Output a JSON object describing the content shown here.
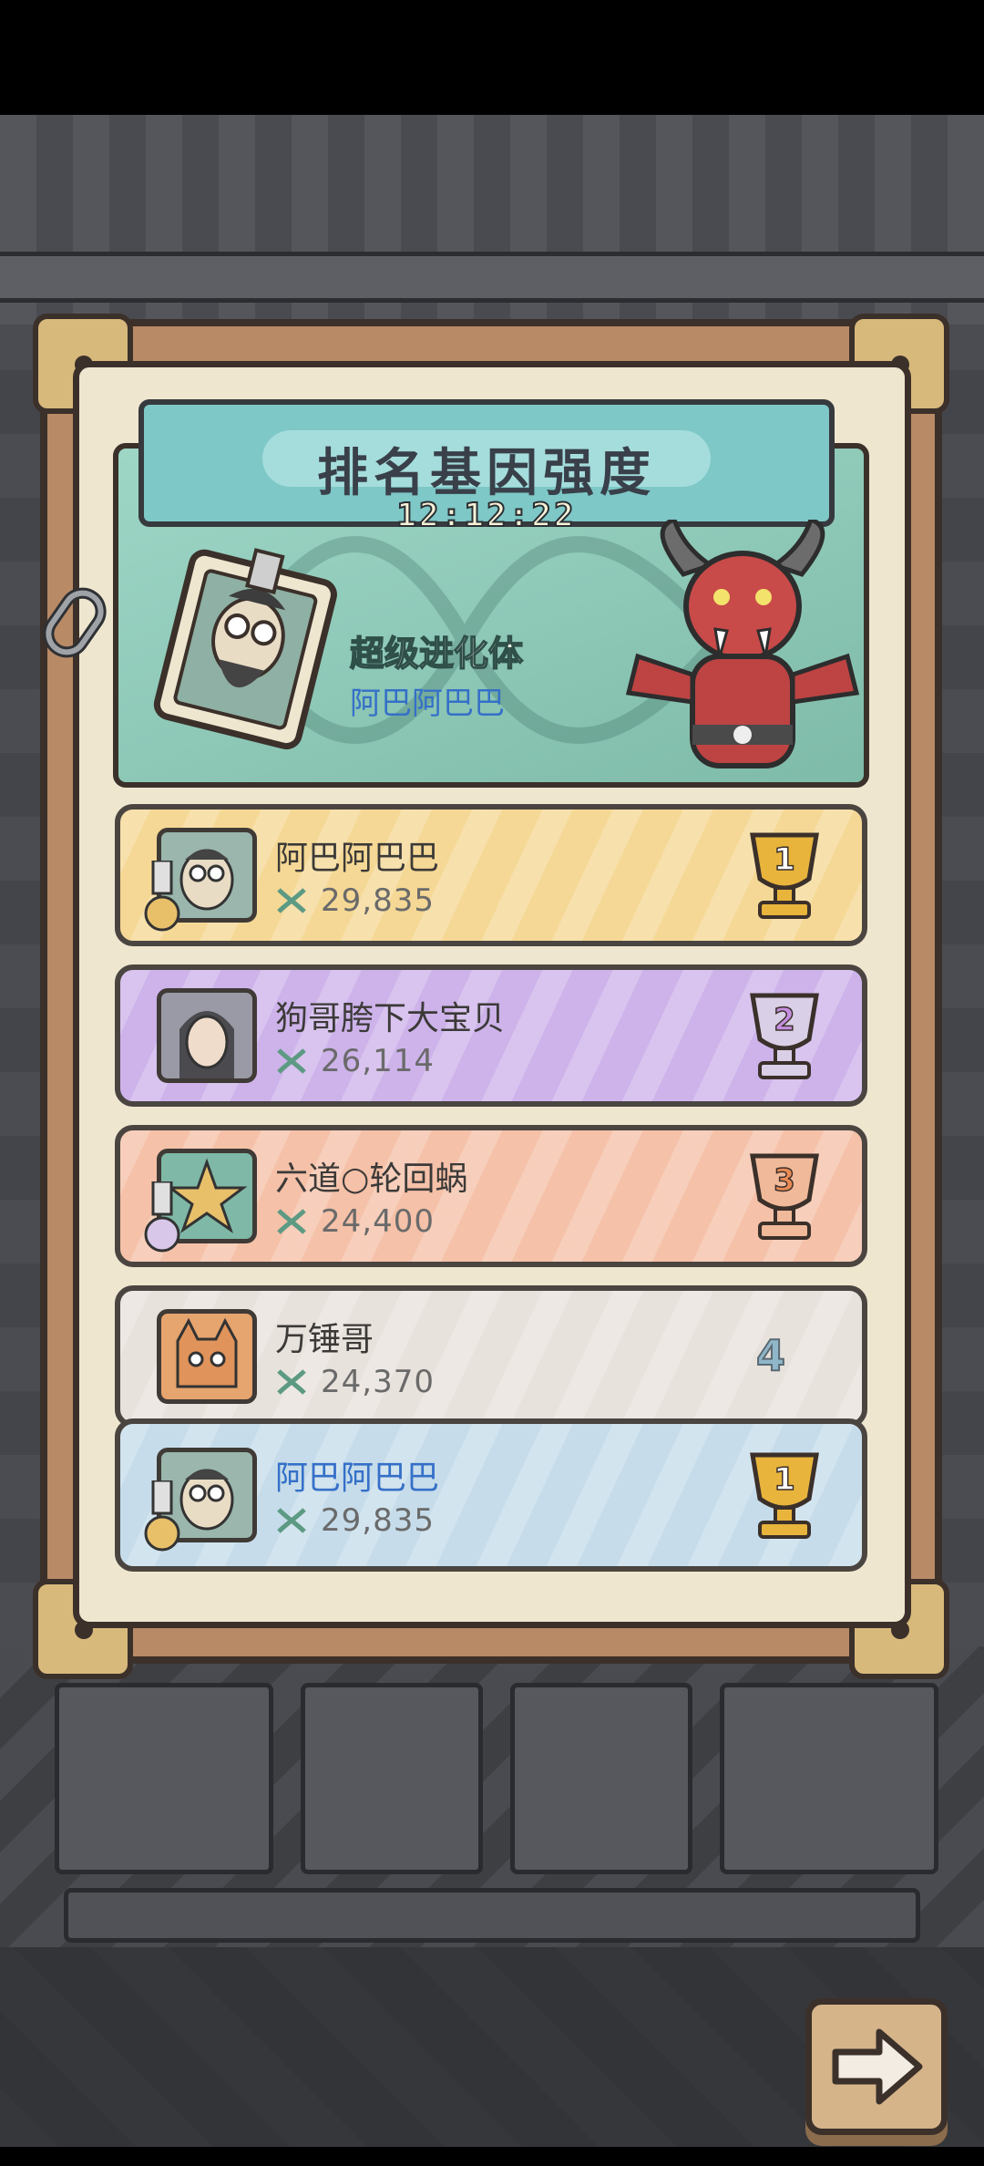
{
  "header": {
    "title": "排名基因强度",
    "timer": "12:12:22"
  },
  "champion": {
    "title": "超级进化体",
    "name": "阿巴阿巴巴"
  },
  "leaderboard": [
    {
      "name": "阿巴阿巴巴",
      "score": "29,835",
      "rank": "1",
      "theme": "gold"
    },
    {
      "name": "狗哥胯下大宝贝",
      "score": "26,114",
      "rank": "2",
      "theme": "purple"
    },
    {
      "name": "六道○轮回蜗",
      "score": "24,400",
      "rank": "3",
      "theme": "orange"
    },
    {
      "name": "万锤哥",
      "score": "24,370",
      "rank": "4",
      "theme": "grey"
    }
  ],
  "self_entry": {
    "name": "阿巴阿巴巴",
    "score": "29,835",
    "rank": "1"
  },
  "icons": {
    "dna": "dna-icon",
    "trophy": "trophy-icon",
    "next": "arrow-right-icon",
    "chain": "chain-link-icon"
  },
  "colors": {
    "gold": "#f5d895",
    "purple": "#cdb3ea",
    "orange": "#f5c1a8",
    "grey": "#e8e2dc",
    "self": "#c6dcea",
    "name_highlight": "#3570c8"
  }
}
